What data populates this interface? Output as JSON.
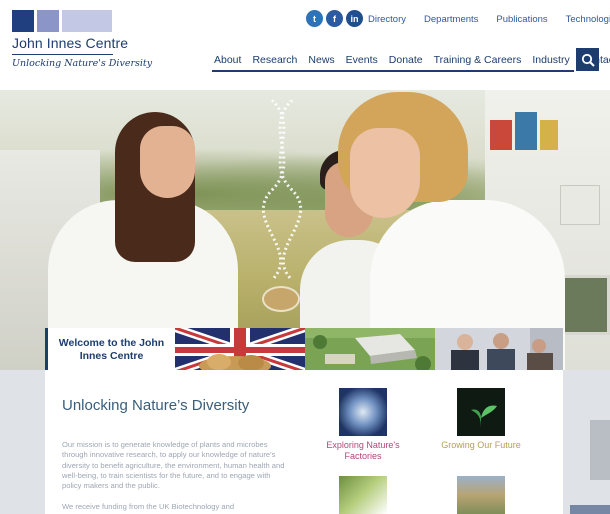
{
  "header": {
    "logo": {
      "name": "John Innes Centre",
      "tagline": "Unlocking Nature's Diversity"
    },
    "social": [
      {
        "icon": "twitter-icon",
        "glyph": "t"
      },
      {
        "icon": "facebook-icon",
        "glyph": "f"
      },
      {
        "icon": "linkedin-icon",
        "glyph": "in"
      }
    ],
    "top_links": [
      "Directory",
      "Departments",
      "Publications",
      "Technologies"
    ],
    "main_nav": [
      "About",
      "Research",
      "News",
      "Events",
      "Donate",
      "Training & Careers",
      "Industry",
      "Contact"
    ],
    "search_icon": "search-icon"
  },
  "feature_strip": {
    "welcome": "Welcome to the John Innes Centre"
  },
  "content": {
    "heading": "Unlocking Nature’s Diversity",
    "paragraph": "Our mission is to generate knowledge of plants and microbes through innovative research, to apply our knowledge of nature's diversity to benefit agriculture, the environment, human health and well-being, to train scientists for the future, and to engage with policy makers and the public.",
    "paragraph2": "We receive funding from the UK Biotechnology and",
    "promos": [
      {
        "label": "Exploring Nature's Factories"
      },
      {
        "label": "Growing Our Future"
      }
    ]
  },
  "colors": {
    "brand_navy": "#1d3d6e",
    "promo_pink": "#b4457a",
    "promo_gold": "#b6a050"
  }
}
